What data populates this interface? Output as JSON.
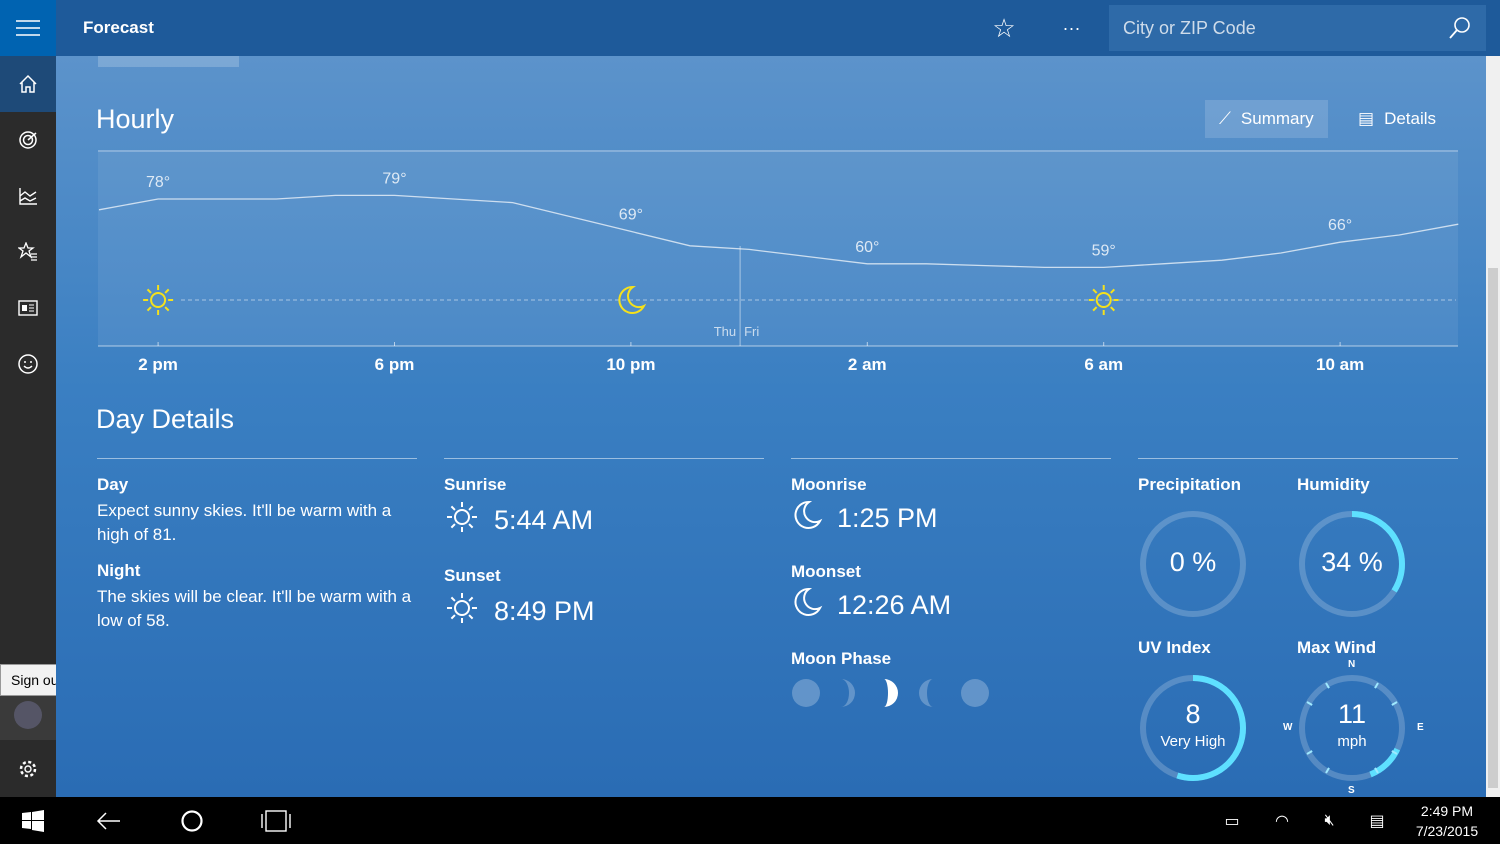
{
  "header": {
    "title": "Forecast",
    "search_placeholder": "City or ZIP Code"
  },
  "sidebar": {
    "items": [
      "home",
      "maps",
      "historical-weather",
      "favorites",
      "news",
      "feedback"
    ],
    "tooltip": "Sign out"
  },
  "hourly": {
    "title": "Hourly",
    "tabs": [
      {
        "label": "Summary",
        "active": true
      },
      {
        "label": "Details",
        "active": false
      }
    ],
    "hour_labels": [
      "2 pm",
      "6 pm",
      "10 pm",
      "2 am",
      "6 am",
      "10 am"
    ],
    "temp_labels": [
      "78°",
      "79°",
      "69°",
      "60°",
      "59°",
      "66°"
    ],
    "day_divider": [
      "Thu",
      "Fri"
    ],
    "hourly_temps": [
      75,
      78,
      78,
      78,
      79,
      79,
      78,
      77,
      73,
      69,
      65,
      64,
      62,
      60,
      60,
      59.5,
      59,
      59,
      60,
      61,
      63,
      66,
      68,
      71
    ],
    "icons": [
      "sun",
      "moon",
      "sun"
    ]
  },
  "day_details": {
    "title": "Day Details",
    "day_label": "Day",
    "day_text": "Expect sunny skies. It'll be warm with a high of 81.",
    "night_label": "Night",
    "night_text": "The skies will be clear. It'll be warm with a low of 58.",
    "sunrise_label": "Sunrise",
    "sunrise": "5:44 AM",
    "sunset_label": "Sunset",
    "sunset": "8:49 PM",
    "moonrise_label": "Moonrise",
    "moonrise": "1:25 PM",
    "moonset_label": "Moonset",
    "moonset": "12:26 AM",
    "moon_phase_label": "Moon Phase",
    "precip_label": "Precipitation",
    "precip": "0 %",
    "precip_value": 0,
    "humidity_label": "Humidity",
    "humidity": "34 %",
    "humidity_value": 34,
    "uv_label": "UV Index",
    "uv": "8",
    "uv_desc": "Very High",
    "uv_fraction": 0.55,
    "wind_label": "Max Wind",
    "wind": "11",
    "wind_unit": "mph",
    "compass": [
      "N",
      "E",
      "S",
      "W"
    ]
  },
  "colors": {
    "accent": "#5ee0ff",
    "sun": "#f5e11c",
    "header": "#1e5a9a"
  },
  "taskbar": {
    "time": "2:49 PM",
    "date": "7/23/2015"
  }
}
